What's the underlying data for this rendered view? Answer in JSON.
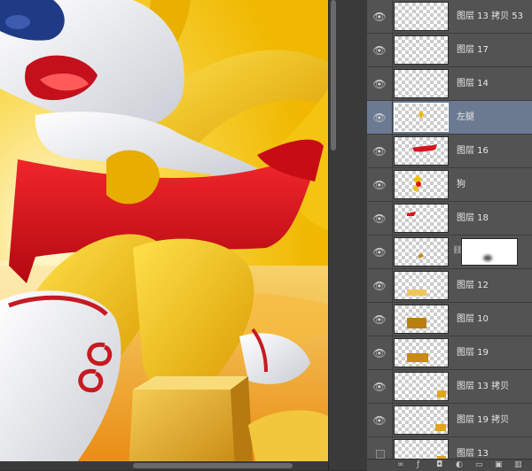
{
  "layers_panel": {
    "layers": [
      {
        "name": "图层 13 拷贝 53",
        "visible": true,
        "selected": false,
        "has_mask": false
      },
      {
        "name": "图层 17",
        "visible": true,
        "selected": false,
        "has_mask": false
      },
      {
        "name": "图层 14",
        "visible": true,
        "selected": false,
        "has_mask": false
      },
      {
        "name": "左腿",
        "visible": true,
        "selected": true,
        "has_mask": false
      },
      {
        "name": "图层 16",
        "visible": true,
        "selected": false,
        "has_mask": false
      },
      {
        "name": "狗",
        "visible": true,
        "selected": false,
        "has_mask": false
      },
      {
        "name": "图层 18",
        "visible": true,
        "selected": false,
        "has_mask": false
      },
      {
        "name": "",
        "visible": true,
        "selected": false,
        "has_mask": true
      },
      {
        "name": "图层 12",
        "visible": true,
        "selected": false,
        "has_mask": false
      },
      {
        "name": "图层 10",
        "visible": true,
        "selected": false,
        "has_mask": false
      },
      {
        "name": "图层 19",
        "visible": true,
        "selected": false,
        "has_mask": false
      },
      {
        "name": "图层 13 拷贝",
        "visible": true,
        "selected": false,
        "has_mask": false
      },
      {
        "name": "图层 19 拷贝",
        "visible": true,
        "selected": false,
        "has_mask": false
      },
      {
        "name": "图层 13",
        "visible": false,
        "selected": false,
        "has_mask": false
      }
    ],
    "eye_glyph": "👁",
    "footer_icons": [
      "link-icon",
      "fx-icon",
      "mask-icon",
      "adjustment-icon",
      "folder-icon",
      "new-layer-icon",
      "trash-icon"
    ]
  },
  "colors": {
    "selected_row": "#6b7a91",
    "panel_bg": "#535353",
    "canvas_yellow": "#f3c40a",
    "scarf_red": "#d8141f"
  }
}
